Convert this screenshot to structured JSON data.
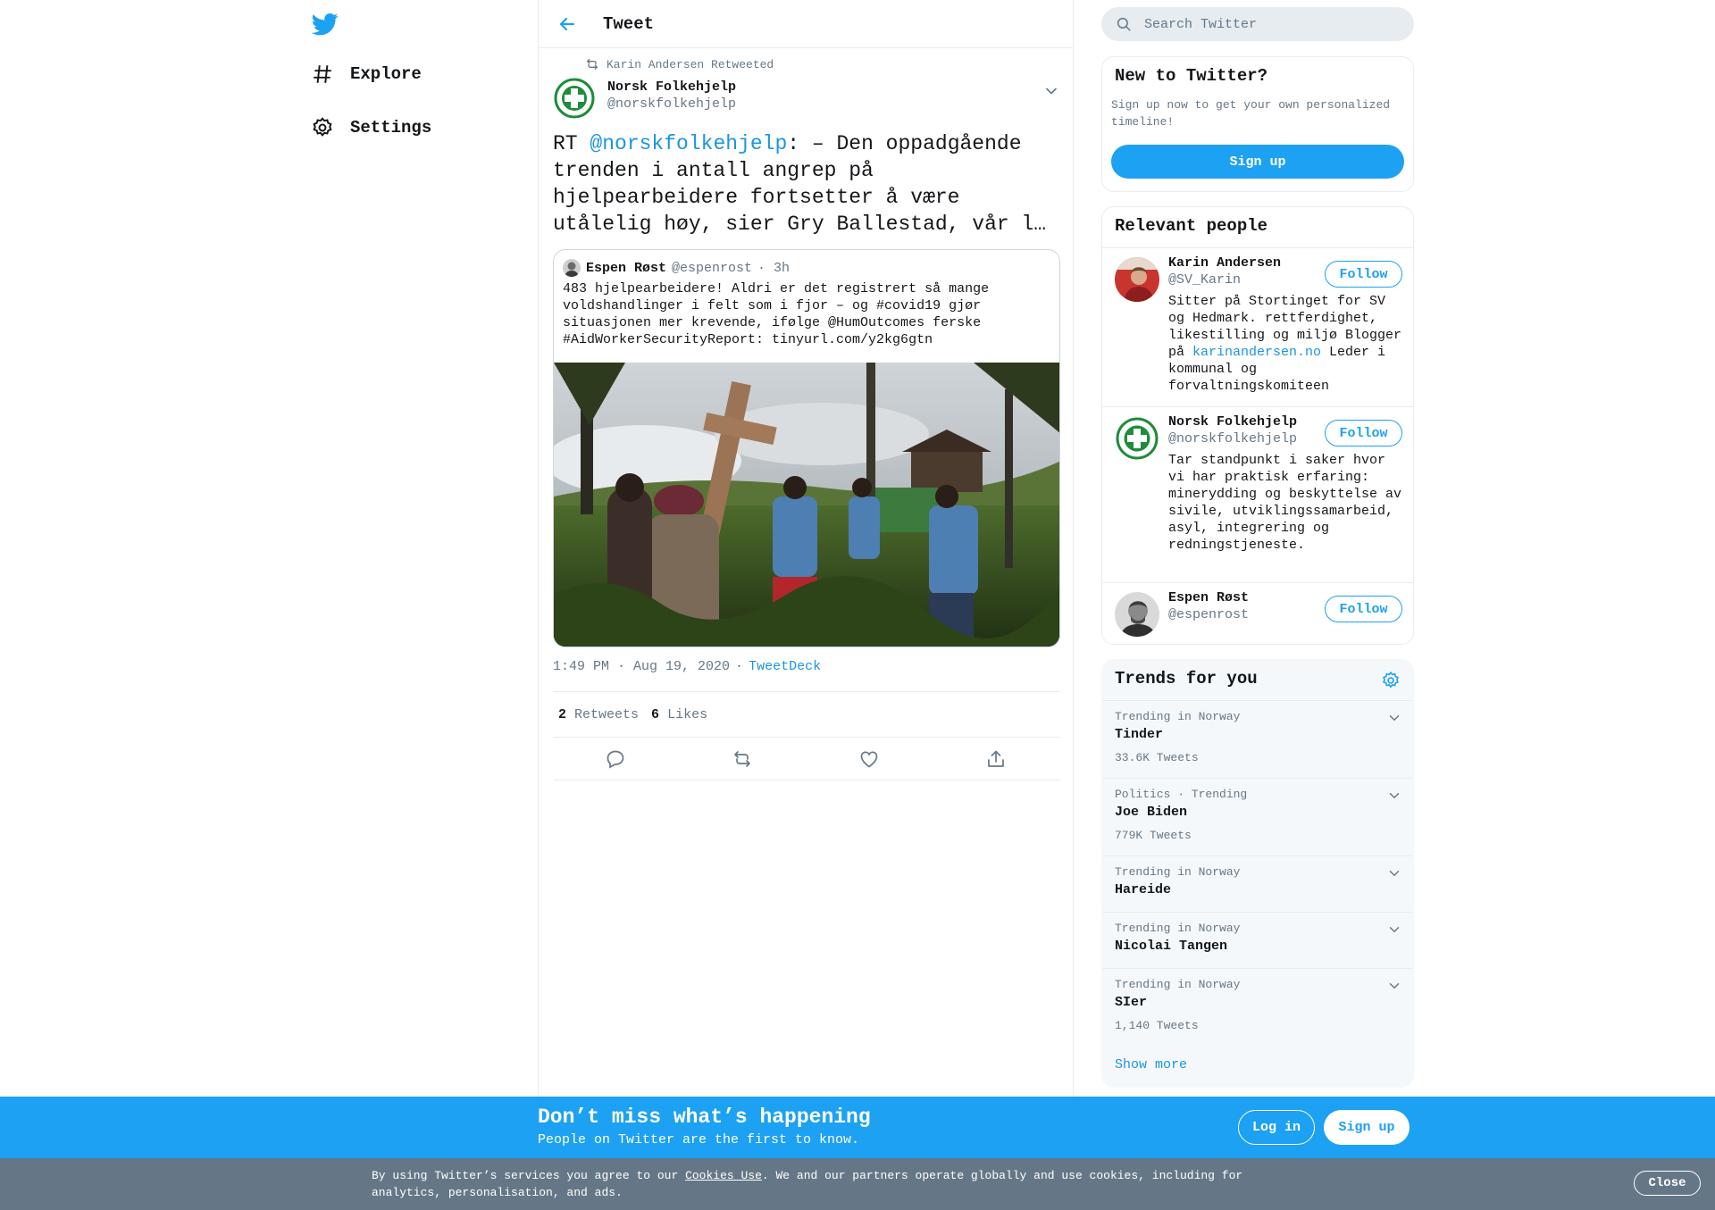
{
  "nav": {
    "explore_label": "Explore",
    "settings_label": "Settings"
  },
  "header": {
    "title": "Tweet"
  },
  "tweet": {
    "retweeted_by": "Karin Andersen Retweeted",
    "author_name": "Norsk Folkehjelp",
    "author_handle": "@norskfolkehjelp",
    "text_prefix": "RT ",
    "mention": "@norskfolkehjelp",
    "text_rest": ": – Den oppadgående trenden i antall angrep på hjelpearbeidere fortsetter å være utålelig høy, sier Gry Ballestad, vår l…",
    "quote": {
      "author_name": "Espen Røst",
      "author_handle": "@espenrost",
      "time": "· 3h",
      "text": "483 hjelpearbeidere! Aldri er det registrert så mange voldshandlinger i felt som i fjor – og #covid19 gjør situasjonen mer krevende, ifølge @HumOutcomes ferske #AidWorkerSecurityReport: tinyurl.com/y2kg6gtn"
    },
    "timestamp": "1:49 PM · Aug 19, 2020",
    "dot": "·",
    "source": "TweetDeck",
    "retweets_count": "2",
    "retweets_label": "Retweets",
    "likes_count": "6",
    "likes_label": "Likes"
  },
  "search": {
    "placeholder": "Search Twitter"
  },
  "new_to_twitter": {
    "title": "New to Twitter?",
    "description": "Sign up now to get your own personalized timeline!",
    "signup_label": "Sign up"
  },
  "relevant": {
    "title": "Relevant people",
    "follow_label": "Follow",
    "people": [
      {
        "name": "Karin Andersen",
        "handle": "@SV_Karin",
        "bio_before": "Sitter på Stortinget for SV og Hedmark. rettferdighet, likestilling og miljø Blogger på ",
        "bio_link": "karinandersen.no",
        "bio_after": " Leder i kommunal og forvaltningskomiteen"
      },
      {
        "name": "Norsk Folkehjelp",
        "handle": "@norskfolkehjelp",
        "bio_before": "Tar standpunkt i saker hvor vi har praktisk erfaring: minerydding og beskyttelse av sivile, utviklingssamarbeid, asyl, integrering og redningstjeneste.",
        "bio_link": "",
        "bio_after": ""
      },
      {
        "name": "Espen Røst",
        "handle": "@espenrost",
        "bio_before": "",
        "bio_link": "",
        "bio_after": ""
      }
    ]
  },
  "trends": {
    "title": "Trends for you",
    "items": [
      {
        "context": "Trending in Norway",
        "name": "Tinder",
        "count": "33.6K Tweets"
      },
      {
        "context": "Politics · Trending",
        "name": "Joe Biden",
        "count": "779K Tweets"
      },
      {
        "context": "Trending in Norway",
        "name": "Hareide",
        "count": ""
      },
      {
        "context": "Trending in Norway",
        "name": "Nicolai Tangen",
        "count": ""
      },
      {
        "context": "Trending in Norway",
        "name": "SIer",
        "count": "1,140 Tweets"
      }
    ],
    "show_more": "Show more"
  },
  "banner": {
    "title": "Don’t miss what’s happening",
    "subtitle": "People on Twitter are the first to know.",
    "login_label": "Log in",
    "signup_label": "Sign up"
  },
  "cookie": {
    "text_before": "By using Twitter’s services you agree to our ",
    "link": "Cookies Use",
    "text_after": ". We and our partners operate globally and use cookies, including for analytics, personalisation, and ads.",
    "close_label": "Close"
  },
  "colors": {
    "accent": "#1da1f2",
    "link": "#1b95e0",
    "secondary_text": "#657786",
    "border": "#e6ecf0",
    "cookie_bg": "#657786"
  }
}
